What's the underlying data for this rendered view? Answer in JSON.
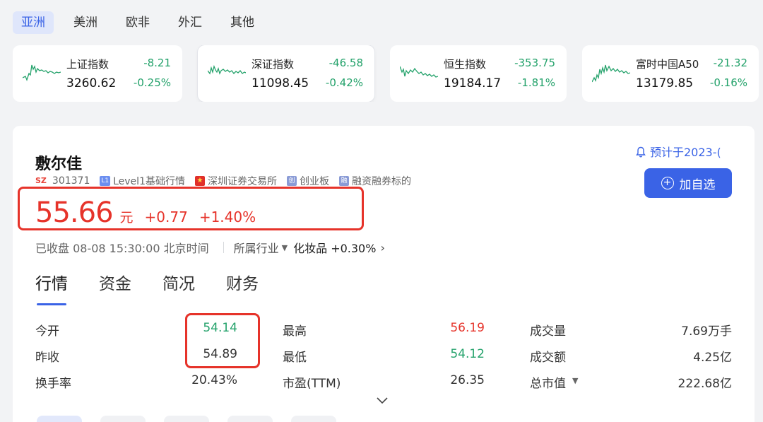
{
  "region_tabs": [
    {
      "label": "亚洲",
      "active": true
    },
    {
      "label": "美洲",
      "active": false
    },
    {
      "label": "欧非",
      "active": false
    },
    {
      "label": "外汇",
      "active": false
    },
    {
      "label": "其他",
      "active": false
    }
  ],
  "index_cards": [
    {
      "name": "上证指数",
      "value": "3260.62",
      "change": "-8.21",
      "pct": "-0.25%"
    },
    {
      "name": "深证指数",
      "value": "11098.45",
      "change": "-46.58",
      "pct": "-0.42%"
    },
    {
      "name": "恒生指数",
      "value": "19184.17",
      "change": "-353.75",
      "pct": "-1.81%"
    },
    {
      "name": "富时中国A50",
      "value": "13179.85",
      "change": "-21.32",
      "pct": "-0.16%"
    }
  ],
  "colors": {
    "up": "#e6332a",
    "down": "#24a26b",
    "accent": "#3a63e6"
  },
  "stock": {
    "name": "敷尔佳",
    "market_badge": "SZ",
    "code": "301371",
    "tags": [
      {
        "badge": "L1",
        "label": "Level1基础行情"
      },
      {
        "badge": "flag",
        "label": "深圳证券交易所"
      },
      {
        "badge": "创",
        "label": "创业板"
      },
      {
        "badge": "融",
        "label": "融资融券标的"
      }
    ],
    "price": "55.66",
    "unit": "元",
    "change": "+0.77",
    "change_pct": "+1.40%",
    "status": "已收盘 08-08 15:30:00 北京时间",
    "industry_label": "所属行业",
    "industry_value": "化妆品 +0.30%"
  },
  "alert_link": "预计于2023-(",
  "add_button": "加自选",
  "tabs": [
    "行情",
    "资金",
    "简况",
    "财务"
  ],
  "quote": [
    [
      {
        "label": "今开",
        "value": "54.14",
        "tone": "green"
      },
      {
        "label": "最高",
        "value": "56.19",
        "tone": "red"
      },
      {
        "label": "成交量",
        "value": "7.69万手",
        "tone": "neutral"
      }
    ],
    [
      {
        "label": "昨收",
        "value": "54.89",
        "tone": "neutral"
      },
      {
        "label": "最低",
        "value": "54.12",
        "tone": "green"
      },
      {
        "label": "成交额",
        "value": "4.25亿",
        "tone": "neutral"
      }
    ],
    [
      {
        "label": "换手率",
        "value": "20.43%",
        "tone": "neutral"
      },
      {
        "label": "市盈(TTM)",
        "value": "26.35",
        "tone": "neutral"
      },
      {
        "label": "总市值",
        "value": "222.68亿",
        "tone": "neutral"
      }
    ]
  ],
  "icons": {
    "bell": "bell-icon",
    "plus": "plus-circle-icon",
    "expand": "chevron-down-icon",
    "sparkline": "sparkline-icon"
  }
}
